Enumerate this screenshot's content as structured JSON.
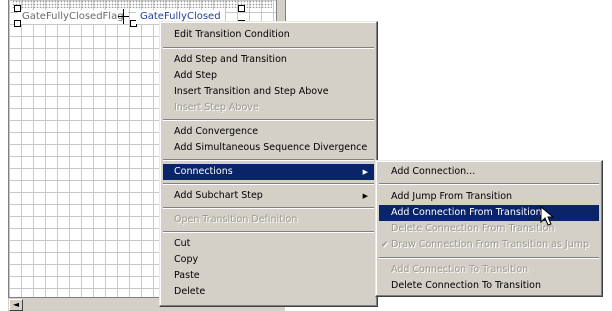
{
  "canvas": {
    "nodes": {
      "flag_label": "GateFullyClosedFlag",
      "step_label": "GateFullyClosed"
    },
    "scroll_left_arrow": "◄"
  },
  "context_menu": {
    "items": [
      {
        "label": "Edit Transition Condition",
        "enabled": true
      },
      {
        "label": "Add Step and Transition",
        "enabled": true
      },
      {
        "label": "Add Step",
        "enabled": true
      },
      {
        "label": "Insert Transition and Step Above",
        "enabled": true
      },
      {
        "label": "Insert Step Above",
        "enabled": false
      },
      {
        "label": "Add Convergence",
        "enabled": true
      },
      {
        "label": "Add Simultaneous Sequence Divergence",
        "enabled": true
      },
      {
        "label": "Connections",
        "enabled": true,
        "submenu": true,
        "highlighted": true
      },
      {
        "label": "Add Subchart Step",
        "enabled": true,
        "submenu": true
      },
      {
        "label": "Open Transition Definition",
        "enabled": false
      },
      {
        "label": "Cut",
        "enabled": true
      },
      {
        "label": "Copy",
        "enabled": true
      },
      {
        "label": "Paste",
        "enabled": true
      },
      {
        "label": "Delete",
        "enabled": true
      }
    ],
    "submenu_arrow": "▶"
  },
  "connections_submenu": {
    "items": [
      {
        "label": "Add Connection...",
        "enabled": true
      },
      {
        "label": "Add Jump From Transition",
        "enabled": true
      },
      {
        "label": "Add Connection From Transition",
        "enabled": true,
        "highlighted": true
      },
      {
        "label": "Delete Connection From Transition",
        "enabled": false
      },
      {
        "label": "Draw Connection From Transition as Jump",
        "enabled": false,
        "checked": true
      },
      {
        "label": "Add Connection To Transition",
        "enabled": false
      },
      {
        "label": "Delete Connection To Transition",
        "enabled": true
      }
    ],
    "check_glyph": "✔"
  },
  "colors": {
    "menu_bg": "#d4d0c8",
    "highlight": "#0a246a",
    "step_text": "#1f3fa0"
  }
}
